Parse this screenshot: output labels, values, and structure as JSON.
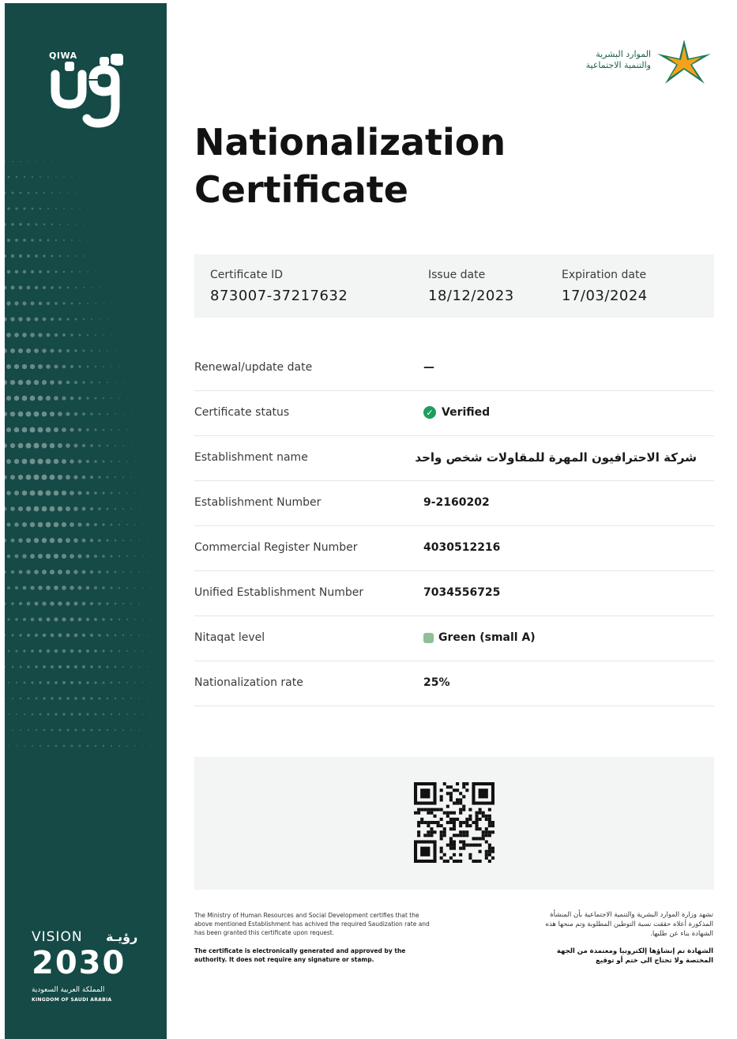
{
  "sidebar": {
    "qiwa_label": "QIWA",
    "vision_word": "VISION",
    "vision_arabic": "رؤيـة",
    "vision_year": "2030",
    "kingdom_arabic": "المملكة العربية السعودية",
    "kingdom_english": "KINGDOM OF SAUDI ARABIA"
  },
  "ministry_logo": {
    "arabic_line1": "الموارد البشرية",
    "arabic_line2": "والتنمية الاجتماعية"
  },
  "title": {
    "line1": "Nationalization",
    "line2": "Certificate"
  },
  "meta": {
    "certificate_id_label": "Certificate ID",
    "certificate_id": "873007-37217632",
    "issue_date_label": "Issue date",
    "issue_date": "18/12/2023",
    "expiration_date_label": "Expiration date",
    "expiration_date": "17/03/2024"
  },
  "details": [
    {
      "label": "Renewal/update date",
      "value": "—"
    },
    {
      "label": "Certificate status",
      "value": "Verified"
    },
    {
      "label": "Establishment name",
      "value": "شركة الاحترافيون المهرة للمقاولات شخص واحد"
    },
    {
      "label": "Establishment Number",
      "value": "9-2160202"
    },
    {
      "label": "Commercial Register Number",
      "value": "4030512216"
    },
    {
      "label": "Unified Establishment Number",
      "value": "7034556725"
    },
    {
      "label": "Nitaqat level",
      "value": "Green (small A)"
    },
    {
      "label": "Nationalization rate",
      "value": "25%"
    }
  ],
  "footer": {
    "english_text": "The Ministry of Human Resources and Social Development certifies that the above mentioned Establishment has achived the required Saudization rate and has been granted this certificate upon request.",
    "english_bold": "The certificate is electronically generated and approved by the authority. It does not require any signature or stamp.",
    "arabic_text": "تشهد وزارة الموارد البشرية والتنمية الاجتماعية بأن المنشأة المذكورة أعلاه حققت نسبة التوطين المطلوبة وتم منحها هذه الشهادة بناء عن طلبها.",
    "arabic_bold": "الشهادة تم إنشاؤها إلكترونيا ومعتمدة من الجهة المختصة ولا تحتاج الى ختم أو توقيع"
  },
  "colors": {
    "sidebar": "#154a46",
    "verified_green": "#1e9e5e",
    "nitaqat_green": "#8fbf98",
    "panel_gray": "#f3f4f4"
  }
}
